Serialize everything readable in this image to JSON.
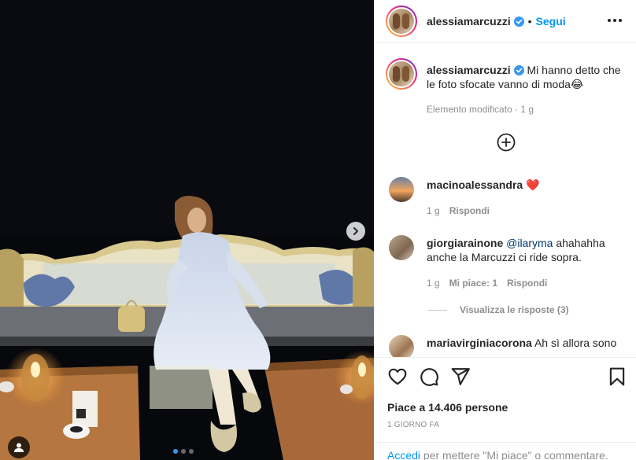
{
  "post": {
    "carousel": {
      "slide_count": 3,
      "active_slide": 1
    }
  },
  "header": {
    "username": "alessiamarcuzzi",
    "bullet": "•",
    "follow_label": "Segui"
  },
  "caption": {
    "username": "alessiamarcuzzi",
    "text": "Mi hanno detto che le foto sfocate vanno di moda😂",
    "meta": "Elemento modificato · 1 g"
  },
  "comments": [
    {
      "username": "macinoalessandra",
      "text": "❤️",
      "time": "1 g",
      "reply_label": "Rispondi"
    },
    {
      "username": "giorgiarainone",
      "mention": "@ilaryma",
      "text": "ahahahha anche la Marcuzzi ci ride sopra.",
      "time": "1 g",
      "likes_label": "Mi piace: 1",
      "reply_label": "Rispondi",
      "view_replies": "Visualizza le risposte (3)"
    },
    {
      "username": "mariavirginiacorona",
      "text": "Ah sì allora sono"
    }
  ],
  "actions": {
    "likes_text": "Piace a 14.406 persone",
    "date": "1 GIORNO FA",
    "login_link": "Accedi",
    "login_text": "per mettere \"Mi piace\" o commentare."
  },
  "colors": {
    "link_blue": "#0095f6",
    "verified_blue": "#3897f0",
    "heart_red": "#ed4956"
  },
  "icons": [
    "chevron-right-icon",
    "user-tag-icon",
    "verified-icon",
    "more-options-icon",
    "plus-circle-icon",
    "heart-icon",
    "comment-icon",
    "share-icon",
    "bookmark-icon"
  ]
}
